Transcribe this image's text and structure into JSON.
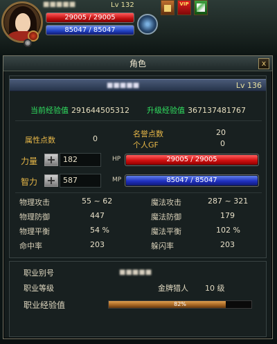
{
  "hud": {
    "level": "Lv 132",
    "hp_text": "29005 / 29005",
    "mp_text": "85047 / 85047",
    "vip_label": "VIP"
  },
  "panel": {
    "title": "角色",
    "close_label": "x",
    "character_level": "Lv 136",
    "current_exp_label": "当前经验值",
    "current_exp_value": "291644505312",
    "next_exp_label": "升级经验值",
    "next_exp_value": "367137481767",
    "attr_points_label": "属性点数",
    "attr_points_value": "0",
    "honor_points_label": "名誉点数",
    "honor_points_value": "20",
    "personal_gf_label": "个人GF",
    "personal_gf_value": "0",
    "strength_label": "力量",
    "strength_value": "182",
    "hp_tag": "HP",
    "hp_text": "29005 / 29005",
    "hp_fraction": 1.0,
    "intelligence_label": "智力",
    "intelligence_value": "587",
    "mp_tag": "MP",
    "mp_text": "85047 / 85047",
    "mp_fraction": 1.0,
    "attributes": {
      "phys_attack_label": "物理攻击",
      "phys_attack_value": "55 ~ 62",
      "magic_attack_label": "魔法攻击",
      "magic_attack_value": "287 ~ 321",
      "phys_def_label": "物理防御",
      "phys_def_value": "447",
      "magic_def_label": "魔法防御",
      "magic_def_value": "179",
      "phys_balance_label": "物理平衡",
      "phys_balance_value": "54 %",
      "magic_balance_label": "魔法平衡",
      "magic_balance_value": "102 %",
      "hit_label": "命中率",
      "hit_value": "203",
      "dodge_label": "躲闪率",
      "dodge_value": "203"
    },
    "job": {
      "alias_label": "职业别号",
      "level_label": "职业等级",
      "level_title": "金牌猎人",
      "level_value": "10 级",
      "exp_label": "职业经验值",
      "exp_text": "82%",
      "exp_fraction": 0.82
    }
  },
  "colors": {
    "hp": "#d01010",
    "mp": "#2030c0",
    "exp_label": "#30e060",
    "gold_label": "#e8b848"
  }
}
